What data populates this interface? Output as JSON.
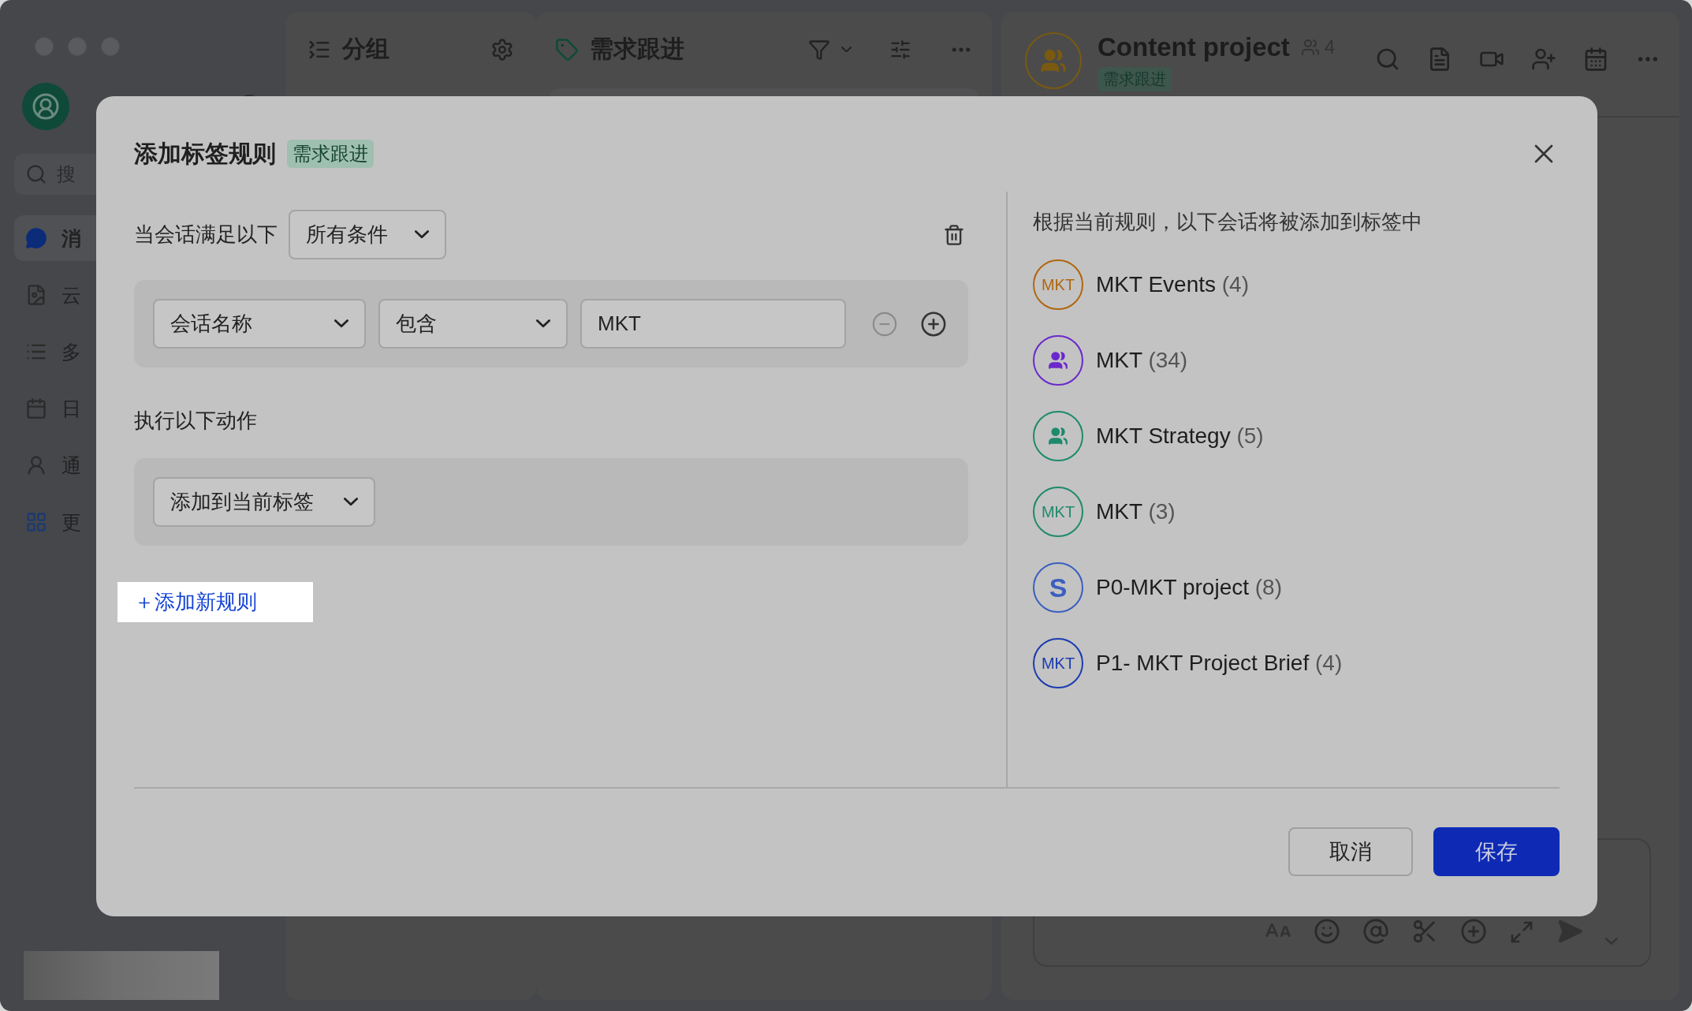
{
  "sidebar": {
    "search_placeholder": "搜",
    "items": [
      {
        "kind": "chat",
        "label": "消",
        "selected": true
      },
      {
        "kind": "docs",
        "label": "云",
        "selected": false
      },
      {
        "kind": "list",
        "label": "多",
        "selected": false
      },
      {
        "kind": "calendar",
        "label": "日",
        "selected": false
      },
      {
        "kind": "contacts",
        "label": "通",
        "selected": false
      },
      {
        "kind": "more",
        "label": "更",
        "selected": false
      }
    ]
  },
  "group_panel": {
    "title": "分组"
  },
  "tag_panel": {
    "title": "需求跟进"
  },
  "chat": {
    "title": "Content project",
    "member_count": "4",
    "tag": "需求跟进"
  },
  "modal": {
    "title": "添加标签规则",
    "tag": "需求跟进",
    "condition_label": "当会话满足以下",
    "match_mode": "所有条件",
    "conditions": [
      {
        "field": "会话名称",
        "operator": "包含",
        "value": "MKT"
      }
    ],
    "action_label": "执行以下动作",
    "action": "添加到当前标签",
    "add_rule": "＋添加新规则",
    "preview_title": "根据当前规则，以下会话将被添加到标签中",
    "preview": [
      {
        "kind": "initials",
        "initials": "MKT",
        "name": "MKT Events",
        "count": "(4)",
        "color": "#b0660e"
      },
      {
        "kind": "group",
        "name": "MKT",
        "count": "(34)",
        "color": "#6a28cc"
      },
      {
        "kind": "group",
        "name": "MKT Strategy",
        "count": "(5)",
        "color": "#1e8a6c"
      },
      {
        "kind": "initials",
        "initials": "MKT",
        "name": "MKT",
        "count": "(3)",
        "color": "#1e8a6c"
      },
      {
        "kind": "initials",
        "initials": "S",
        "name": "P0-MKT project",
        "count": "(8)",
        "color": "#3a5fbf"
      },
      {
        "kind": "initials",
        "initials": "MKT",
        "name": "P1- MKT Project Brief",
        "count": "(4)",
        "color": "#1a3bb0"
      }
    ],
    "cancel": "取消",
    "save": "保存"
  }
}
